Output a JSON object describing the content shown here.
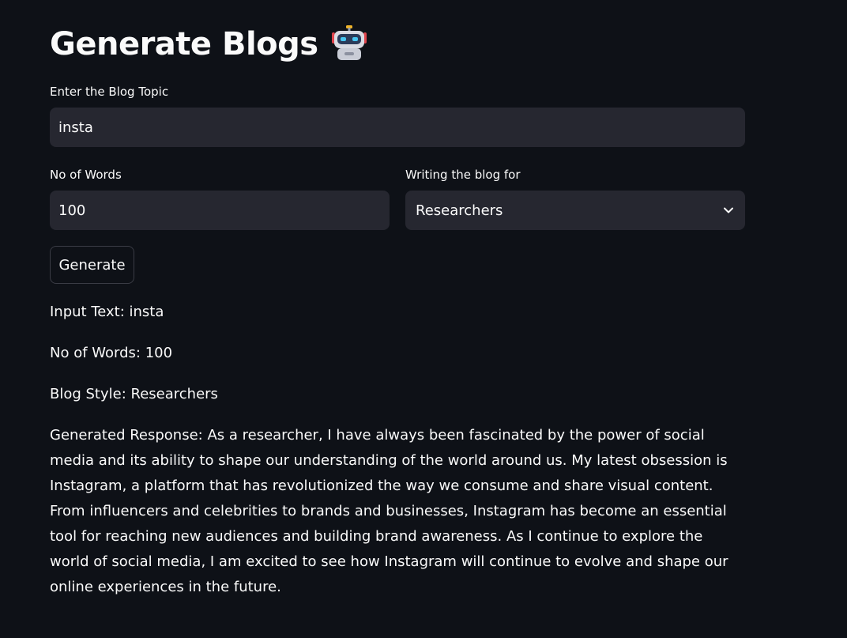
{
  "header": {
    "title": "Generate Blogs",
    "icon": "robot-icon"
  },
  "form": {
    "topic_label": "Enter the Blog Topic",
    "topic_value": "insta",
    "words_label": "No of Words",
    "words_value": "100",
    "audience_label": "Writing the blog for",
    "audience_selected": "Researchers",
    "generate_label": "Generate"
  },
  "output": {
    "input_text": "Input Text: insta",
    "no_of_words": "No of Words: 100",
    "blog_style": "Blog Style: Researchers",
    "response": "Generated Response: As a researcher, I have always been fascinated by the power of social media and its ability to shape our understanding of the world around us. My latest obsession is Instagram, a platform that has revolutionized the way we consume and share visual content. From influencers and celebrities to brands and businesses, Instagram has become an essential tool for reaching new audiences and building brand awareness. As I continue to explore the world of social media, I am excited to see how Instagram will continue to evolve and shape our online experiences in the future."
  },
  "colors": {
    "background": "#0e1117",
    "input_bg": "#262730",
    "text": "#fafafa"
  }
}
